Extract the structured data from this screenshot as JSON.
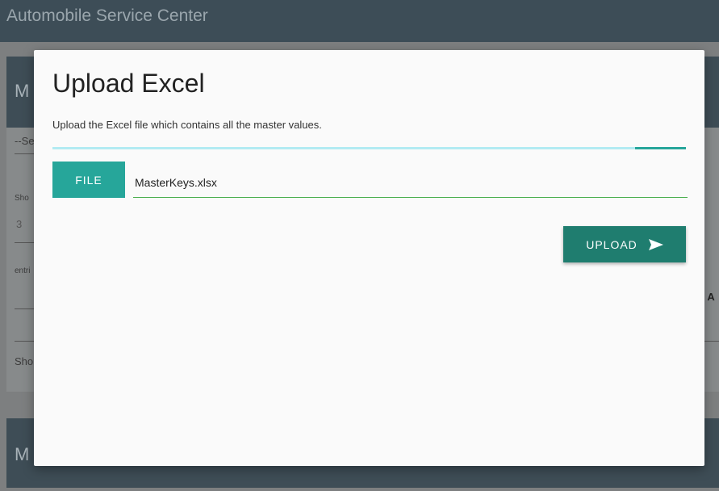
{
  "app": {
    "title": "Automobile Service Center"
  },
  "background": {
    "card1_heading": "M",
    "select_text": "--Se",
    "show_label": "Sho",
    "show_value": "3",
    "entries_label": "entri",
    "side_text": "s A",
    "show_footer": "Sho",
    "card2_heading": "M"
  },
  "modal": {
    "title": "Upload Excel",
    "description": "Upload the Excel file which contains all the master values.",
    "progress_percent": 92,
    "file_button_label": "FILE",
    "file_path_value": "MasterKeys.xlsx",
    "upload_button_label": "UPLOAD",
    "upload_icon": "send-icon"
  },
  "colors": {
    "accent": "#26a69a",
    "upload_button": "#1f7d6f",
    "progress_track": "#b2ebf2",
    "input_underline": "#4caf50"
  }
}
